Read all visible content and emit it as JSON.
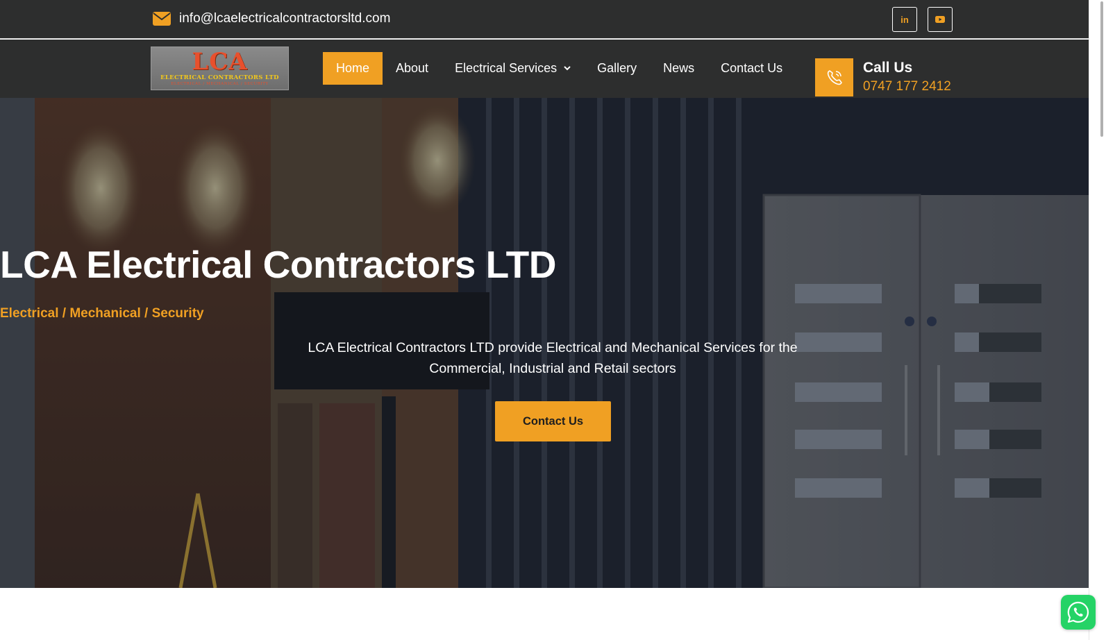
{
  "topbar": {
    "email": "info@lcaelectricalcontractorsltd.com",
    "social": [
      {
        "name": "linkedin",
        "label": "in"
      },
      {
        "name": "youtube"
      }
    ]
  },
  "header": {
    "logo": {
      "mark": "LCA",
      "line1": "ELECTRICAL CONTRACTORS LTD",
      "line2": "ELECTRICAL / MECHANICAL / SECURITY"
    },
    "nav": [
      {
        "label": "Home",
        "active": true
      },
      {
        "label": "About"
      },
      {
        "label": "Electrical Services",
        "dropdown": true
      },
      {
        "label": "Gallery"
      },
      {
        "label": "News"
      },
      {
        "label": "Contact Us"
      }
    ],
    "call": {
      "title": "Call Us",
      "number": "0747 177 2412"
    }
  },
  "hero": {
    "title": "LCA Electrical Contractors LTD",
    "tagline": "Electrical / Mechanical / Security",
    "description": "LCA Electrical Contractors LTD provide Electrical and Mechanical Services for the Commercial, Industrial and Retail sectors",
    "cta": "Contact Us"
  },
  "colors": {
    "accent": "#f0a023",
    "dark": "#2d2e2e",
    "whatsapp": "#25d366"
  }
}
